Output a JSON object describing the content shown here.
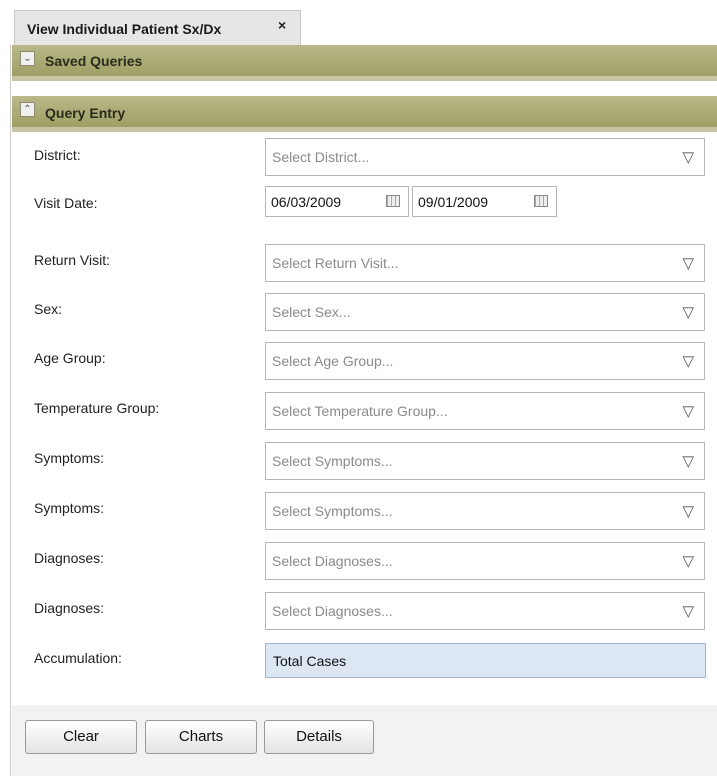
{
  "tab": {
    "title": "View Individual Patient Sx/Dx",
    "close_glyph": "×"
  },
  "sections": {
    "saved_queries": {
      "title": "Saved Queries",
      "icon": "expand-icon"
    },
    "query_entry": {
      "title": "Query Entry",
      "icon": "collapse-icon"
    }
  },
  "form": {
    "district": {
      "label": "District:",
      "placeholder": "Select District..."
    },
    "visit_date": {
      "label": "Visit Date:",
      "from": "06/03/2009",
      "to": "09/01/2009"
    },
    "return_visit": {
      "label": "Return Visit:",
      "placeholder": "Select Return Visit..."
    },
    "sex": {
      "label": "Sex:",
      "placeholder": "Select Sex..."
    },
    "age_group": {
      "label": "Age Group:",
      "placeholder": "Select Age Group..."
    },
    "temperature_group": {
      "label": "Temperature Group:",
      "placeholder": "Select Temperature Group..."
    },
    "symptoms_1": {
      "label": "Symptoms:",
      "placeholder": "Select Symptoms..."
    },
    "symptoms_2": {
      "label": "Symptoms:",
      "placeholder": "Select Symptoms..."
    },
    "diagnoses_1": {
      "label": "Diagnoses:",
      "placeholder": "Select Diagnoses..."
    },
    "diagnoses_2": {
      "label": "Diagnoses:",
      "placeholder": "Select Diagnoses..."
    },
    "accumulation": {
      "label": "Accumulation:",
      "value": "Total Cases"
    }
  },
  "buttons": {
    "clear": "Clear",
    "charts": "Charts",
    "details": "Details"
  },
  "colors": {
    "header_olive": "#9a9a5e",
    "accumulation_bg": "#dde7f4"
  }
}
